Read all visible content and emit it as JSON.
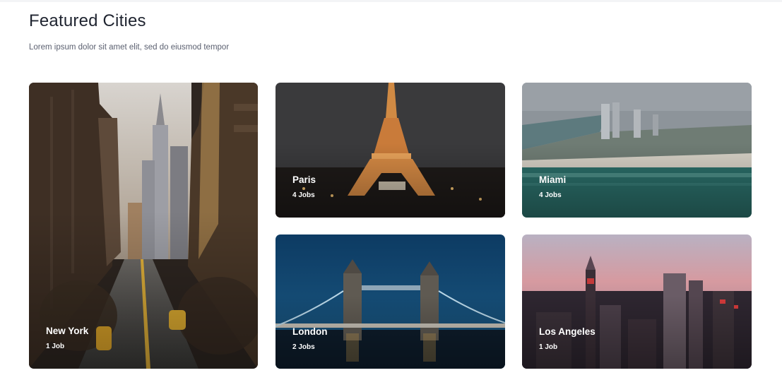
{
  "section": {
    "title": "Featured Cities",
    "subtitle": "Lorem ipsum dolor sit amet elit, sed do eiusmod tempor"
  },
  "cities": [
    {
      "name": "New York",
      "jobs": "1 Job"
    },
    {
      "name": "Paris",
      "jobs": "4 Jobs"
    },
    {
      "name": "Miami",
      "jobs": "4 Jobs"
    },
    {
      "name": "London",
      "jobs": "2 Jobs"
    },
    {
      "name": "Los Angeles",
      "jobs": "1 Job"
    }
  ]
}
